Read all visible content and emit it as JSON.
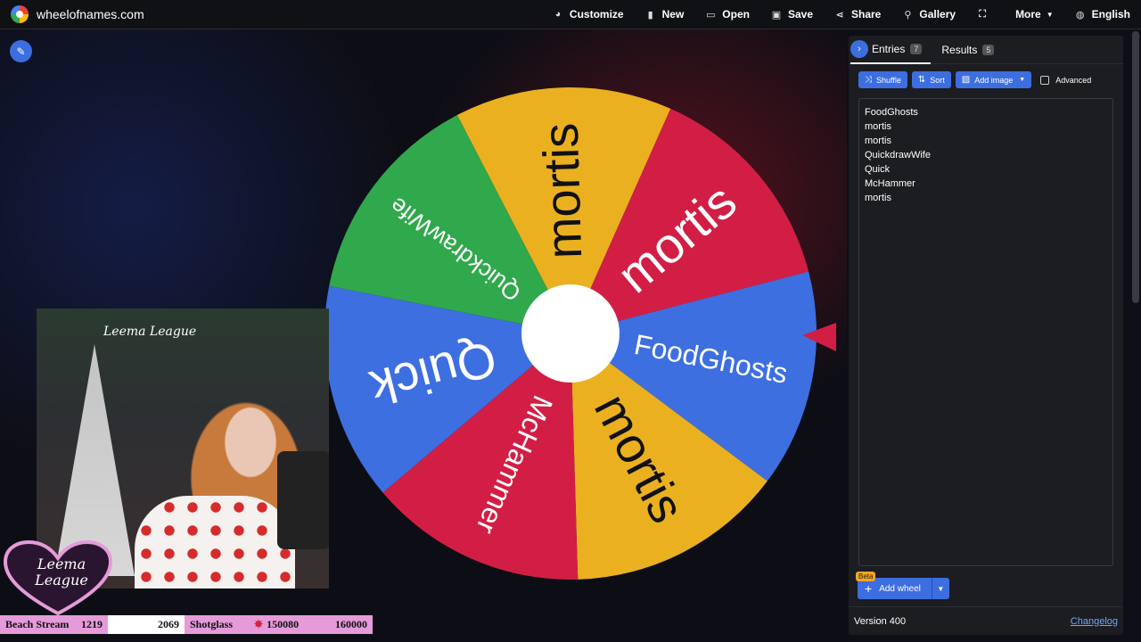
{
  "app": {
    "title": "wheelofnames.com"
  },
  "nav": {
    "customize": "Customize",
    "new": "New",
    "open": "Open",
    "save": "Save",
    "share": "Share",
    "gallery": "Gallery",
    "more": "More",
    "language": "English"
  },
  "wheel": {
    "segments": [
      {
        "label": "mortis",
        "color": "#eab01f"
      },
      {
        "label": "mortis",
        "color": "#d21e45"
      },
      {
        "label": "FoodGhosts",
        "color": "#3d6fe0"
      },
      {
        "label": "mortis",
        "color": "#eab01f"
      },
      {
        "label": "McHammer",
        "color": "#d21e45"
      },
      {
        "label": "Quick",
        "color": "#3d6fe0"
      },
      {
        "label": "QuickdrawWife",
        "color": "#30a84c"
      }
    ],
    "pointer_color": "#d21e45"
  },
  "panel": {
    "tabs": [
      {
        "label": "Entries",
        "count": "7"
      },
      {
        "label": "Results",
        "count": "5"
      }
    ],
    "toolbar": {
      "shuffle": "Shuffle",
      "sort": "Sort",
      "add_image": "Add image",
      "advanced": "Advanced"
    },
    "entries": [
      "FoodGhosts",
      "mortis",
      "mortis",
      "QuickdrawWife",
      "Quick",
      "McHammer",
      "mortis"
    ],
    "add_wheel": {
      "beta": "Beta",
      "label": "Add wheel"
    },
    "version": "Version 400",
    "changelog": "Changelog"
  },
  "stream": {
    "overlay_sign": "Leema League",
    "badge_line1": "Leema",
    "badge_line2": "League",
    "bar": {
      "beach_label": "Beach Stream",
      "beach_value": "1219",
      "beach_goal": "2069",
      "shot_label": "Shotglass",
      "shot_value": "150080",
      "shot_goal": "160000"
    }
  },
  "colors": {
    "accent": "#3d6ee0",
    "panel_bg": "#1c1d21",
    "topbar_bg": "#101114",
    "badge_pink": "#e59bd9"
  }
}
